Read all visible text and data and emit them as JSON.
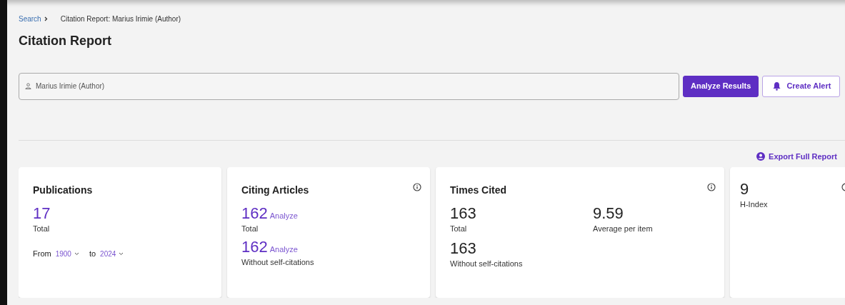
{
  "breadcrumb": [
    {
      "label": "Search",
      "kind": "link"
    },
    {
      "label": "Citation Report: Marius Irimie (Author)",
      "kind": "current"
    }
  ],
  "title": "Citation Report",
  "search": {
    "value": "Marius Irimie (Author)"
  },
  "buttons": [
    {
      "label": "Analyze Results",
      "kind": "primary"
    },
    {
      "label": "Create Alert",
      "kind": "outline"
    }
  ],
  "export_link": "Export Full Report",
  "cards": [
    {
      "kind": "stack",
      "title": "Publications",
      "info": false,
      "metrics": [
        {
          "value": "17",
          "caption": "Total",
          "linked": true
        }
      ],
      "range": {
        "from_label": "From",
        "from": "1900",
        "to_label": "to",
        "to": "2024"
      }
    },
    {
      "kind": "stack",
      "title": "Citing Articles",
      "info": true,
      "metrics": [
        {
          "value": "162",
          "action": "Analyze",
          "caption": "Total",
          "linked": true
        },
        {
          "value": "162",
          "action": "Analyze",
          "caption": "Without self-citations",
          "linked": true
        }
      ]
    },
    {
      "kind": "grid",
      "title": "Times Cited",
      "info": true,
      "metrics": [
        {
          "value": "163",
          "caption": "Total",
          "linked": false
        },
        {
          "value": "9.59",
          "caption": "Average per item",
          "linked": false
        },
        {
          "value": "163",
          "caption": "Without self-citations",
          "linked": false
        }
      ]
    },
    {
      "kind": "index",
      "info": true,
      "metrics": [
        {
          "value": "9",
          "caption": "H-Index",
          "linked": false
        }
      ]
    }
  ]
}
